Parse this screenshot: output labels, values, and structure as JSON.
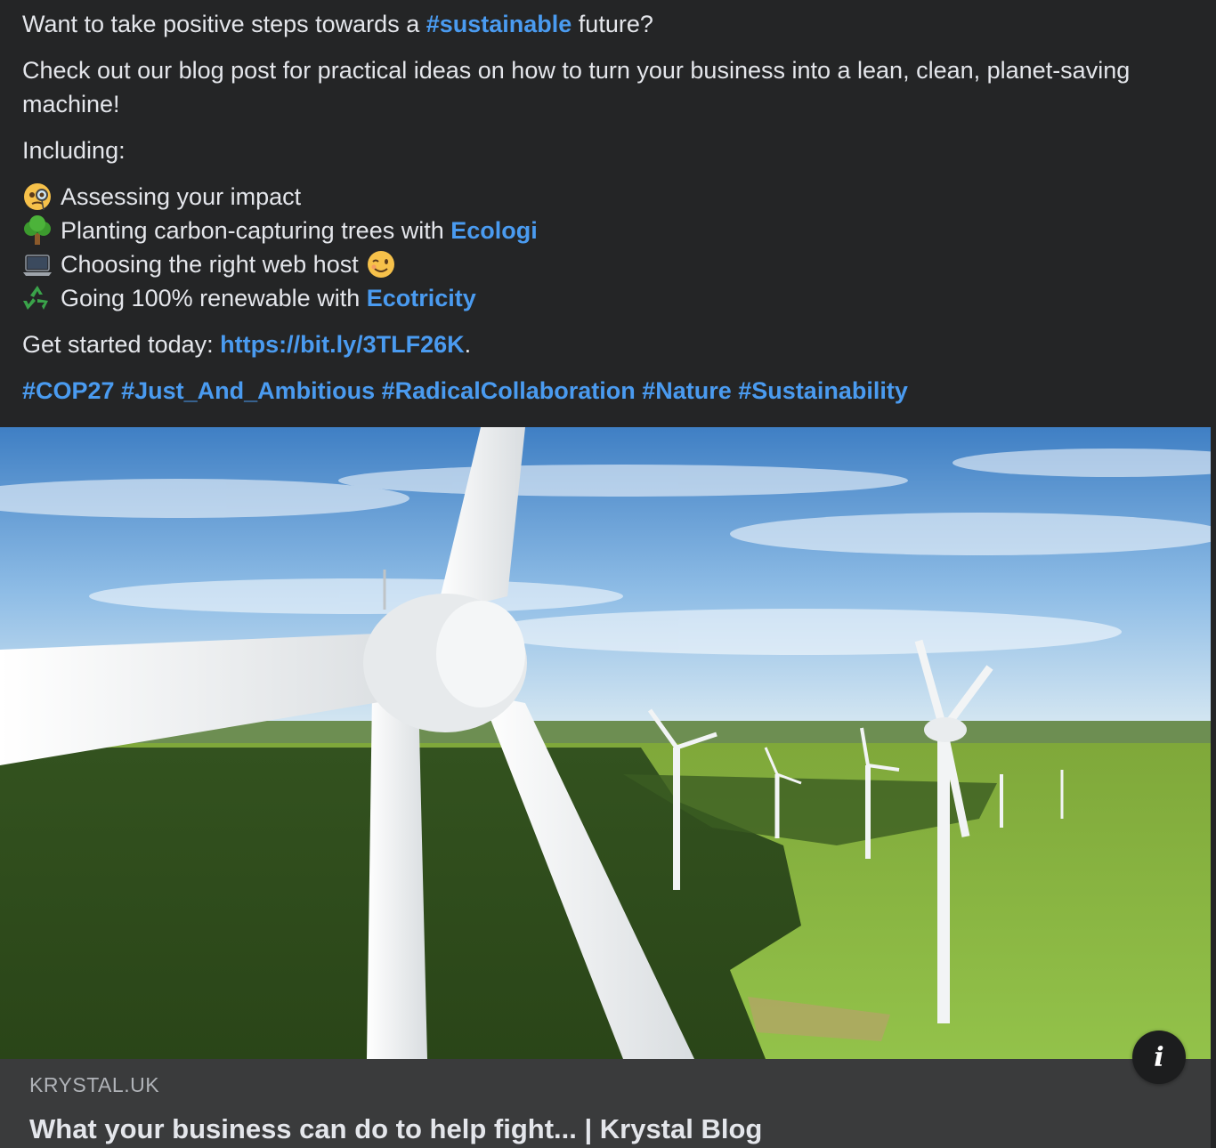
{
  "post": {
    "line1": {
      "before": "Want to take positive steps towards a ",
      "hashtag": "#sustainable",
      "after": " future?"
    },
    "paragraph2": "Check out our blog post for practical ideas on how to turn your business into a lean, clean, planet-saving machine!",
    "including": "Including:",
    "list": [
      {
        "icon": "monocle-face-icon",
        "text": "Assessing your impact",
        "link": ""
      },
      {
        "icon": "tree-icon",
        "text": "Planting carbon-capturing trees with ",
        "link": "Ecologi"
      },
      {
        "icon": "laptop-icon",
        "text": "Choosing the right web host",
        "link": "",
        "trailing_icon": "winking-face-icon"
      },
      {
        "icon": "recycle-icon",
        "text": "Going 100% renewable with ",
        "link": "Ecotricity"
      }
    ],
    "get_started": {
      "before": "Get started today: ",
      "url": "https://bit.ly/3TLF26K",
      "after": "."
    },
    "hashtags": [
      "#COP27",
      "#Just_And_Ambitious",
      "#RadicalCollaboration",
      "#Nature",
      "#Sustainability"
    ]
  },
  "link_preview": {
    "image": "wind-turbines-photo",
    "domain": "KRYSTAL.UK",
    "title": "What your business can do to help fight... | Krystal Blog"
  },
  "info_button": {
    "icon": "info-icon",
    "glyph": "i"
  },
  "colors": {
    "background": "#242526",
    "text": "#e4e6eb",
    "link": "#4a9bf0",
    "meta_background": "#3a3b3c"
  }
}
